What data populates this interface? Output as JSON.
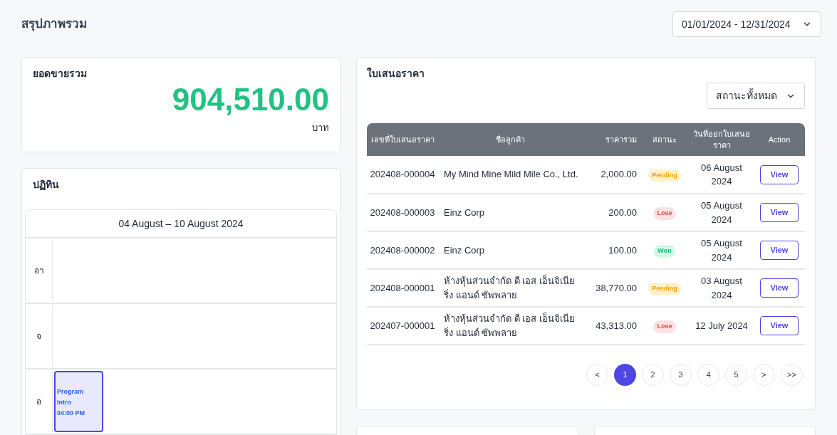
{
  "page_title": "สรุปภาพรวม",
  "date_range": "01/01/2024 - 12/31/2024",
  "sales_card": {
    "title": "ยอดขายรวม",
    "amount": "904,510.00",
    "unit": "บาท"
  },
  "calendar_card": {
    "title": "ปฏิทิน",
    "week_label": "04 August – 10 August 2024",
    "days": [
      {
        "label": "อา"
      },
      {
        "label": "จ"
      },
      {
        "label": "อ",
        "events": [
          {
            "title": "Program Intro",
            "time": "04:00 PM"
          }
        ]
      }
    ]
  },
  "quotes_card": {
    "title": "ใบเสนอราคา",
    "status_filter": "สถานะทั้งหมด",
    "columns": [
      "เลขที่ใบเสนอราคา",
      "ชื่อลูกค้า",
      "ราคารวม",
      "สถานะ",
      "วันที่ออกใบเสนอราคา",
      "Action"
    ],
    "rows": [
      {
        "number": "202408-000004",
        "customer": "My Mind Mine Mild Mile Co., Ltd.",
        "total": "2,000.00",
        "status": {
          "kind": "pending",
          "label": "Pending"
        },
        "date": "06 August 2024",
        "action": "View"
      },
      {
        "number": "202408-000003",
        "customer": "Einz Corp",
        "total": "200.00",
        "status": {
          "kind": "lose",
          "label": "Lose"
        },
        "date": "05 August 2024",
        "action": "View"
      },
      {
        "number": "202408-000002",
        "customer": "Einz Corp",
        "total": "100.00",
        "status": {
          "kind": "won",
          "label": "Won"
        },
        "date": "05 August 2024",
        "action": "View"
      },
      {
        "number": "202408-000001",
        "customer": "ห้างหุ้นส่วนจำกัด ดี เอส เอ็นจิเนียริ่ง แอนด์ ซัพพลาย",
        "total": "38,770.00",
        "status": {
          "kind": "pending",
          "label": "Pending"
        },
        "date": "03 August 2024",
        "action": "View"
      },
      {
        "number": "202407-000001",
        "customer": "ห้างหุ้นส่วนจำกัด ดี เอส เอ็นจิเนียริ่ง แอนด์ ซัพพลาย",
        "total": "43,313.00",
        "status": {
          "kind": "lose",
          "label": "Lose"
        },
        "date": "12 July 2024",
        "action": "View"
      }
    ],
    "pagination": [
      {
        "label": "<",
        "selected": false
      },
      {
        "label": "1",
        "selected": true
      },
      {
        "label": "2",
        "selected": false
      },
      {
        "label": "3",
        "selected": false
      },
      {
        "label": "4",
        "selected": false
      },
      {
        "label": "5",
        "selected": false
      },
      {
        "label": ">",
        "selected": false
      },
      {
        "label": ">>",
        "selected": false
      }
    ]
  }
}
